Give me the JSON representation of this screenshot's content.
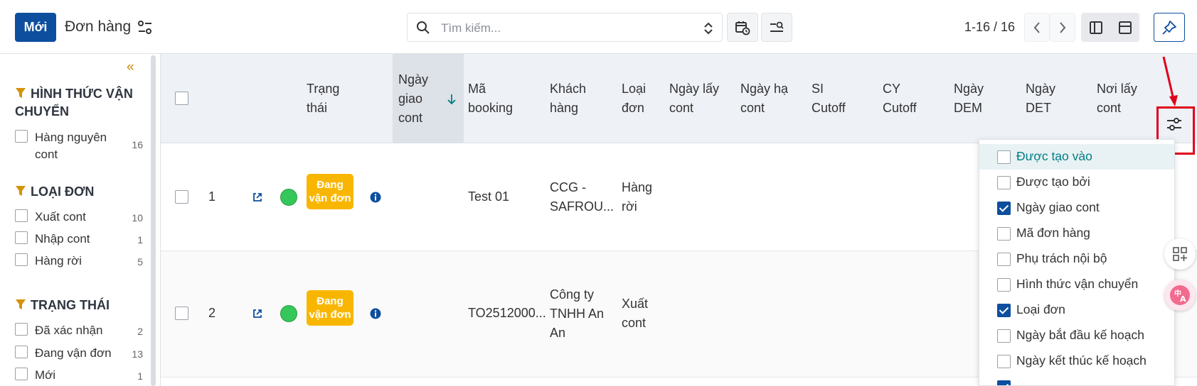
{
  "topbar": {
    "new_label": "Mới",
    "title": "Đơn hàng",
    "search_placeholder": "Tìm kiếm...",
    "pager": "1-16 / 16"
  },
  "sidebar": {
    "collapse_glyph": "«",
    "groups": [
      {
        "title": "HÌNH THỨC VẬN CHUYỂN",
        "items": [
          {
            "label": "Hàng nguyên cont",
            "count": "16"
          }
        ]
      },
      {
        "title": "LOẠI ĐƠN",
        "items": [
          {
            "label": "Xuất cont",
            "count": "10"
          },
          {
            "label": "Nhập cont",
            "count": "1"
          },
          {
            "label": "Hàng rời",
            "count": "5"
          }
        ]
      },
      {
        "title": "TRẠNG THÁI",
        "items": [
          {
            "label": "Đã xác nhận",
            "count": "2"
          },
          {
            "label": "Đang vận đơn",
            "count": "13"
          },
          {
            "label": "Mới",
            "count": "1"
          }
        ]
      }
    ]
  },
  "table": {
    "headers": {
      "status": "Trạng thái",
      "delivery_date": "Ngày giao cont",
      "booking": "Mã booking",
      "customer": "Khách hàng",
      "order_type": "Loại đơn",
      "pickup_date": "Ngày lấy cont",
      "drop_date": "Ngày hạ cont",
      "si_cutoff": "SI Cutoff",
      "cy_cutoff": "CY Cutoff",
      "dem_date": "Ngày DEM",
      "det_date": "Ngày DET",
      "pickup_place": "Nơi lấy cont"
    },
    "rows": [
      {
        "index": "1",
        "status": "Đang vận đơn",
        "booking": "Test 01",
        "customer": "CCG - SAFROU...",
        "order_type": "Hàng rời"
      },
      {
        "index": "2",
        "status": "Đang vận đơn",
        "booking": "TO2512000...",
        "customer": "Công ty TNHH An An",
        "order_type": "Xuất cont"
      }
    ]
  },
  "column_menu": {
    "items": [
      {
        "label": "Được tạo vào",
        "checked": false,
        "highlighted": true
      },
      {
        "label": "Được tạo bởi",
        "checked": false
      },
      {
        "label": "Ngày giao cont",
        "checked": true
      },
      {
        "label": "Mã đơn hàng",
        "checked": false
      },
      {
        "label": "Phụ trách nội bộ",
        "checked": false
      },
      {
        "label": "Hình thức vận chuyển",
        "checked": false
      },
      {
        "label": "Loại đơn",
        "checked": true
      },
      {
        "label": "Ngày bắt đầu kế hoạch",
        "checked": false
      },
      {
        "label": "Ngày kết thúc kế hoạch",
        "checked": false
      }
    ]
  },
  "colors": {
    "primary": "#0d4f9e",
    "status_badge": "#f9b600",
    "status_dot": "#35c759",
    "annotation_red": "#e0001a"
  }
}
